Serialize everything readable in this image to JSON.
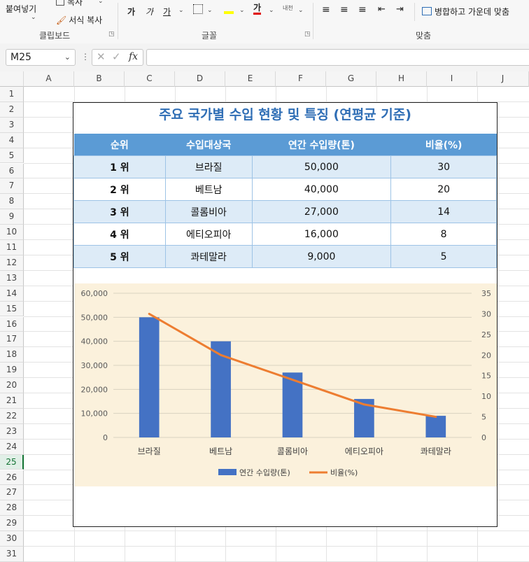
{
  "ribbon": {
    "clipboard": {
      "paste_label": "붙여넣기",
      "copy_label": "복사",
      "format_painter_label": "서식 복사",
      "group_label": "클립보드"
    },
    "font": {
      "group_label": "글꼴",
      "bold_glyph": "가",
      "italic_glyph": "가",
      "underline_glyph": "가",
      "fontcolor_glyph": "가",
      "phonetic_glyph": "내천"
    },
    "alignment": {
      "merge_center_label": "병합하고 가운데 맞춤",
      "group_label": "맞춤"
    }
  },
  "formula_bar": {
    "name_box": "M25",
    "fx": "fx",
    "formula": ""
  },
  "columns": [
    "A",
    "B",
    "C",
    "D",
    "E",
    "F",
    "G",
    "H",
    "I",
    "J"
  ],
  "rows": [
    "1",
    "2",
    "3",
    "4",
    "5",
    "6",
    "7",
    "8",
    "9",
    "10",
    "11",
    "12",
    "13",
    "14",
    "15",
    "16",
    "17",
    "18",
    "19",
    "20",
    "21",
    "22",
    "23",
    "24",
    "25",
    "26",
    "27",
    "28",
    "29",
    "30",
    "31"
  ],
  "selected_row": "25",
  "sheet": {
    "title": "주요 국가별 수입 현황 및 특징 (연평균 기준)",
    "headers": [
      "순위",
      "수입대상국",
      "연간 수입량(톤)",
      "비율(%)"
    ],
    "rows": [
      {
        "rank": "1 위",
        "country": "브라질",
        "amount": "50,000",
        "ratio": "30"
      },
      {
        "rank": "2 위",
        "country": "베트남",
        "amount": "40,000",
        "ratio": "20"
      },
      {
        "rank": "3 위",
        "country": "콜롬비아",
        "amount": "27,000",
        "ratio": "14"
      },
      {
        "rank": "4 위",
        "country": "에티오피아",
        "amount": "16,000",
        "ratio": "8"
      },
      {
        "rank": "5 위",
        "country": "콰테말라",
        "amount": "9,000",
        "ratio": "5"
      }
    ]
  },
  "chart_data": {
    "type": "bar",
    "categories": [
      "브라질",
      "베트남",
      "콜롬비아",
      "에티오피아",
      "콰테말라"
    ],
    "series": [
      {
        "name": "연간 수입량(톤)",
        "type": "bar",
        "axis": "left",
        "color": "#4472c4",
        "values": [
          50000,
          40000,
          27000,
          16000,
          9000
        ]
      },
      {
        "name": "비율(%)",
        "type": "line",
        "axis": "right",
        "color": "#ed7d31",
        "values": [
          30,
          20,
          14,
          8,
          5
        ]
      }
    ],
    "y_left": {
      "min": 0,
      "max": 60000,
      "ticks": [
        "0",
        "10,000",
        "20,000",
        "30,000",
        "40,000",
        "50,000",
        "60,000"
      ]
    },
    "y_right": {
      "min": 0,
      "max": 35,
      "ticks": [
        "0",
        "5",
        "10",
        "15",
        "20",
        "25",
        "30",
        "35"
      ]
    },
    "grid": true,
    "legend": "bottom",
    "background": "#fbf1dc"
  }
}
